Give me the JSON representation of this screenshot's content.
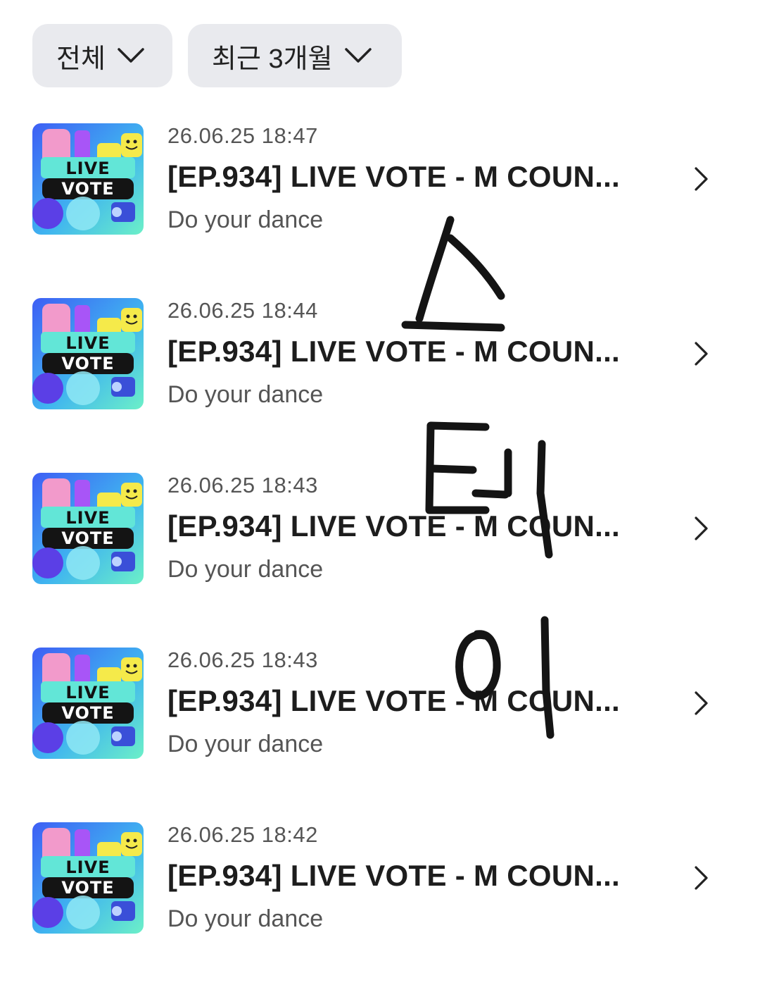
{
  "filters": {
    "scope": {
      "label": "전체",
      "icon": "chevron-down-icon"
    },
    "period": {
      "label": "최근 3개월",
      "icon": "chevron-down-icon"
    }
  },
  "items": [
    {
      "date": "26.06.25 18:47",
      "title": "[EP.934] LIVE VOTE - M COUN...",
      "subtitle": "Do your dance",
      "thumb_line1": "LIVE",
      "thumb_line2": "VOTE"
    },
    {
      "date": "26.06.25 18:44",
      "title": "[EP.934] LIVE VOTE - M COUN...",
      "subtitle": "Do your dance",
      "thumb_line1": "LIVE",
      "thumb_line2": "VOTE"
    },
    {
      "date": "26.06.25 18:43",
      "title": "[EP.934] LIVE VOTE - M COUN...",
      "subtitle": "Do your dance",
      "thumb_line1": "LIVE",
      "thumb_line2": "VOTE"
    },
    {
      "date": "26.06.25 18:43",
      "title": "[EP.934] LIVE VOTE - M COUN...",
      "subtitle": "Do your dance",
      "thumb_line1": "LIVE",
      "thumb_line2": "VOTE"
    },
    {
      "date": "26.06.25 18:42",
      "title": "[EP.934] LIVE VOTE - M COUN...",
      "subtitle": "Do your dance",
      "thumb_line1": "LIVE",
      "thumb_line2": "VOTE"
    }
  ],
  "handwriting": "스테이"
}
